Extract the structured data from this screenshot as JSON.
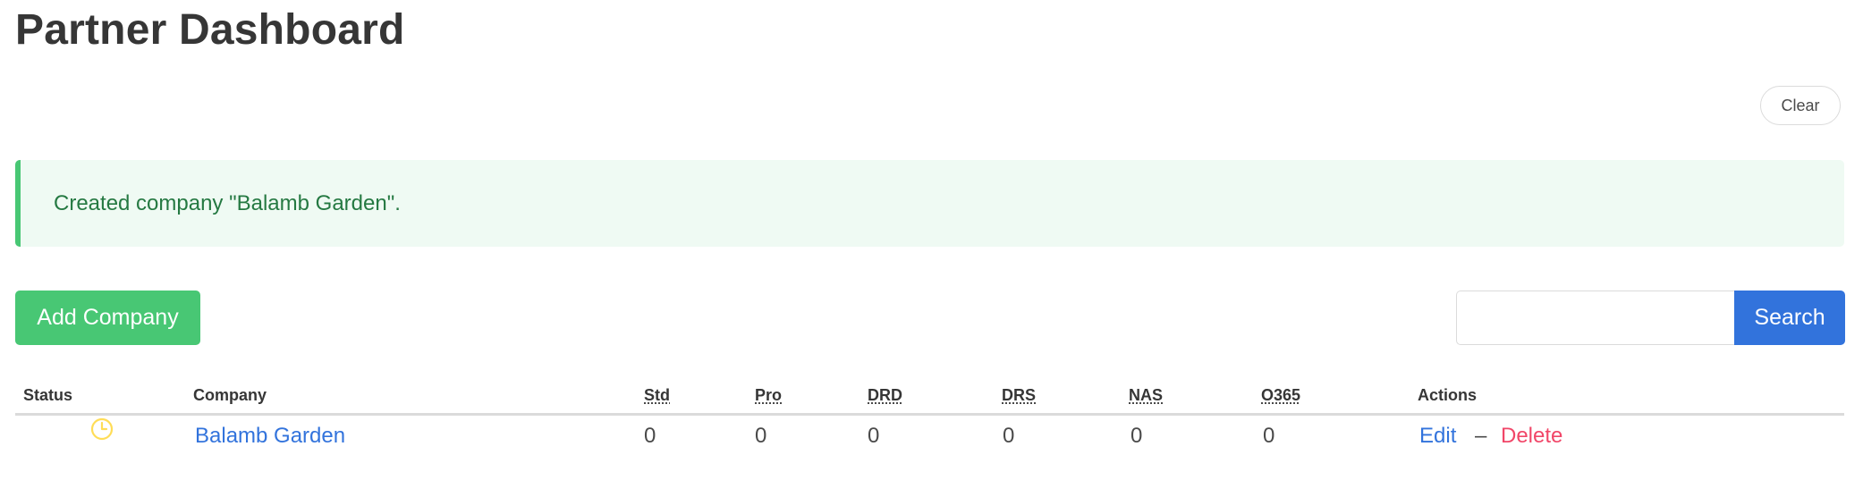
{
  "page": {
    "title": "Partner Dashboard"
  },
  "toolbar": {
    "clear_label": "Clear"
  },
  "notification": {
    "message": "Created company \"Balamb Garden\"."
  },
  "actions": {
    "add_company_label": "Add Company",
    "search_placeholder": "",
    "search_value": "",
    "search_label": "Search"
  },
  "table": {
    "headers": {
      "status": "Status",
      "company": "Company",
      "std": "Std",
      "pro": "Pro",
      "drd": "DRD",
      "drs": "DRS",
      "nas": "NAS",
      "o365": "O365",
      "actions": "Actions"
    },
    "rows": [
      {
        "status_icon": "clock-icon",
        "company": "Balamb Garden",
        "std": "0",
        "pro": "0",
        "drd": "0",
        "drs": "0",
        "nas": "0",
        "o365": "0",
        "edit_label": "Edit",
        "separator": "–",
        "delete_label": "Delete"
      }
    ]
  },
  "colors": {
    "primary": "#3273dc",
    "success": "#48c774",
    "danger": "#f14668",
    "notification_bg": "#effaf3",
    "notification_text": "#257942",
    "status_icon": "#ffdd57"
  }
}
